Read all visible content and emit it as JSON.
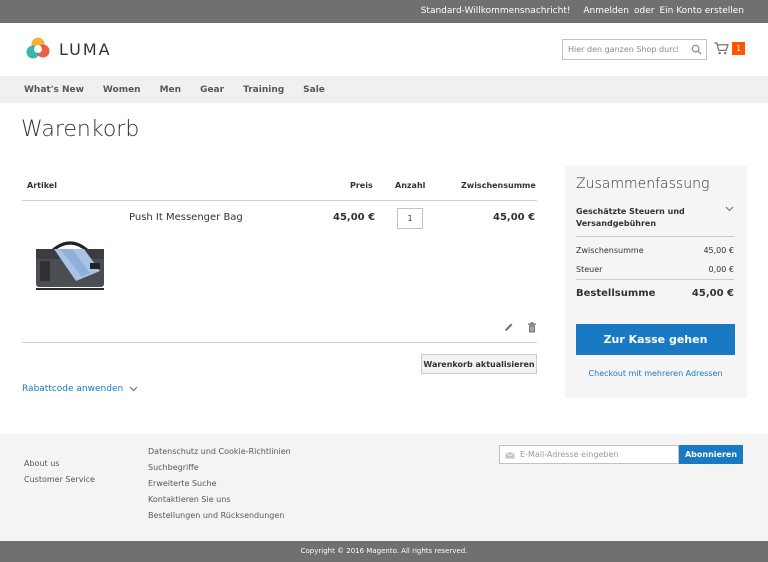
{
  "topbar": {
    "welcome": "Standard-Willkommensnachricht!",
    "sign_in": "Anmelden",
    "or": "oder",
    "create_account": "Ein Konto erstellen"
  },
  "header": {
    "logo_text": "LUMA",
    "search_placeholder": "Hier den ganzen Shop durchsuc",
    "cart_count": "1"
  },
  "nav": {
    "items": [
      "What's New",
      "Women",
      "Men",
      "Gear",
      "Training",
      "Sale"
    ]
  },
  "page": {
    "title": "Warenkorb"
  },
  "cart": {
    "headers": {
      "item": "Artikel",
      "price": "Preis",
      "qty": "Anzahl",
      "subtotal": "Zwischensumme"
    },
    "items": [
      {
        "name": "Push It Messenger Bag",
        "price": "45,00 €",
        "qty": "1",
        "subtotal": "45,00 €"
      }
    ],
    "update_label": "Warenkorb aktualisieren",
    "discount_label": "Rabattcode anwenden"
  },
  "summary": {
    "title": "Zusammenfassung",
    "tax_estimate": "Geschätzte Steuern und Versandgebühren",
    "subtotal_label": "Zwischensumme",
    "subtotal_value": "45,00 €",
    "tax_label": "Steuer",
    "tax_value": "0,00 €",
    "total_label": "Bestellsumme",
    "total_value": "45,00 €",
    "checkout_label": "Zur Kasse gehen",
    "multi_address_label": "Checkout mit mehreren Adressen"
  },
  "footer": {
    "col1": [
      "About us",
      "Customer Service"
    ],
    "col2": [
      "Datenschutz und Cookie-Richtlinien",
      "Suchbegriffe",
      "Erweiterte Suche",
      "Kontaktieren Sie uns",
      "Bestellungen und Rücksendungen"
    ],
    "newsletter_placeholder": "E-Mail-Adresse eingeben",
    "subscribe_label": "Abonnieren",
    "copyright": "Copyright © 2016 Magento. All rights reserved."
  },
  "colors": {
    "brand_blue": "#1979c3",
    "counter_orange": "#ff5501",
    "bar_gray": "#6e716e"
  }
}
